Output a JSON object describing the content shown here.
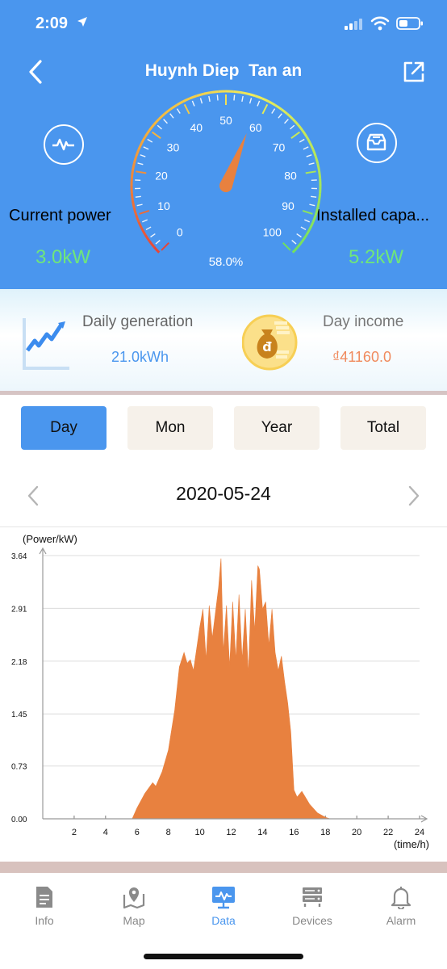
{
  "status_bar": {
    "time": "2:09"
  },
  "header": {
    "title": "Huynh Diep  Tan an",
    "current_power": {
      "label": "Current power",
      "value": "3.0kW"
    },
    "installed_capacity": {
      "label": "Installed capa...",
      "value": "5.2kW"
    },
    "gauge": {
      "percent_text": "58.0%",
      "percent": 58.0,
      "ticks": [
        "0",
        "10",
        "20",
        "30",
        "40",
        "50",
        "60",
        "70",
        "80",
        "90",
        "100"
      ]
    }
  },
  "summary": {
    "daily_generation": {
      "label": "Daily generation",
      "value": "21.0kWh"
    },
    "day_income": {
      "label": "Day income",
      "value": "₫41160.0"
    }
  },
  "tabs": [
    {
      "label": "Day",
      "active": true
    },
    {
      "label": "Mon",
      "active": false
    },
    {
      "label": "Year",
      "active": false
    },
    {
      "label": "Total",
      "active": false
    }
  ],
  "date_nav": {
    "date": "2020-05-24"
  },
  "chart_data": {
    "type": "area",
    "ylabel": "(Power/kW)",
    "xlabel": "(time/h)",
    "y_ticks": [
      "0.00",
      "0.73",
      "1.45",
      "2.18",
      "2.91",
      "3.64"
    ],
    "x_ticks": [
      "2",
      "4",
      "6",
      "8",
      "10",
      "12",
      "14",
      "16",
      "18",
      "20",
      "22",
      "24"
    ],
    "xlim": [
      0,
      24
    ],
    "ylim": [
      0,
      3.64
    ],
    "color": "#e8813f",
    "x": [
      5.7,
      6.0,
      6.5,
      7.0,
      7.2,
      7.6,
      8.0,
      8.4,
      8.7,
      9.0,
      9.2,
      9.4,
      9.6,
      9.8,
      10.0,
      10.2,
      10.4,
      10.6,
      10.8,
      11.0,
      11.2,
      11.35,
      11.5,
      11.7,
      11.9,
      12.1,
      12.3,
      12.5,
      12.7,
      12.9,
      13.1,
      13.3,
      13.5,
      13.7,
      13.8,
      14.0,
      14.2,
      14.4,
      14.6,
      14.8,
      15.0,
      15.2,
      15.4,
      15.6,
      15.8,
      16.0,
      16.2,
      16.5,
      17.0,
      17.5,
      18.0,
      18.3
    ],
    "y": [
      0.0,
      0.15,
      0.35,
      0.5,
      0.45,
      0.65,
      0.95,
      1.5,
      2.1,
      2.3,
      2.15,
      2.2,
      2.05,
      2.35,
      2.65,
      2.9,
      2.2,
      2.95,
      2.5,
      2.85,
      3.2,
      3.6,
      2.3,
      2.95,
      2.1,
      3.0,
      2.2,
      3.1,
      2.2,
      2.9,
      2.0,
      3.3,
      2.6,
      3.5,
      3.45,
      2.9,
      3.0,
      2.4,
      2.9,
      2.3,
      2.05,
      2.25,
      1.9,
      1.6,
      1.2,
      0.4,
      0.3,
      0.38,
      0.2,
      0.08,
      0.02,
      0.0
    ]
  },
  "tabbar": {
    "items": [
      {
        "label": "Info",
        "icon": "document-icon"
      },
      {
        "label": "Map",
        "icon": "map-pin-icon"
      },
      {
        "label": "Data",
        "icon": "monitor-chart-icon"
      },
      {
        "label": "Devices",
        "icon": "server-icon"
      },
      {
        "label": "Alarm",
        "icon": "bell-icon"
      }
    ],
    "active": "Data"
  },
  "colors": {
    "header_bg": "#4a96ee",
    "accent": "#4a96ee",
    "value_green": "#6fe67a",
    "income_orange": "#f08a5d",
    "chart_fill": "#e8813f"
  }
}
